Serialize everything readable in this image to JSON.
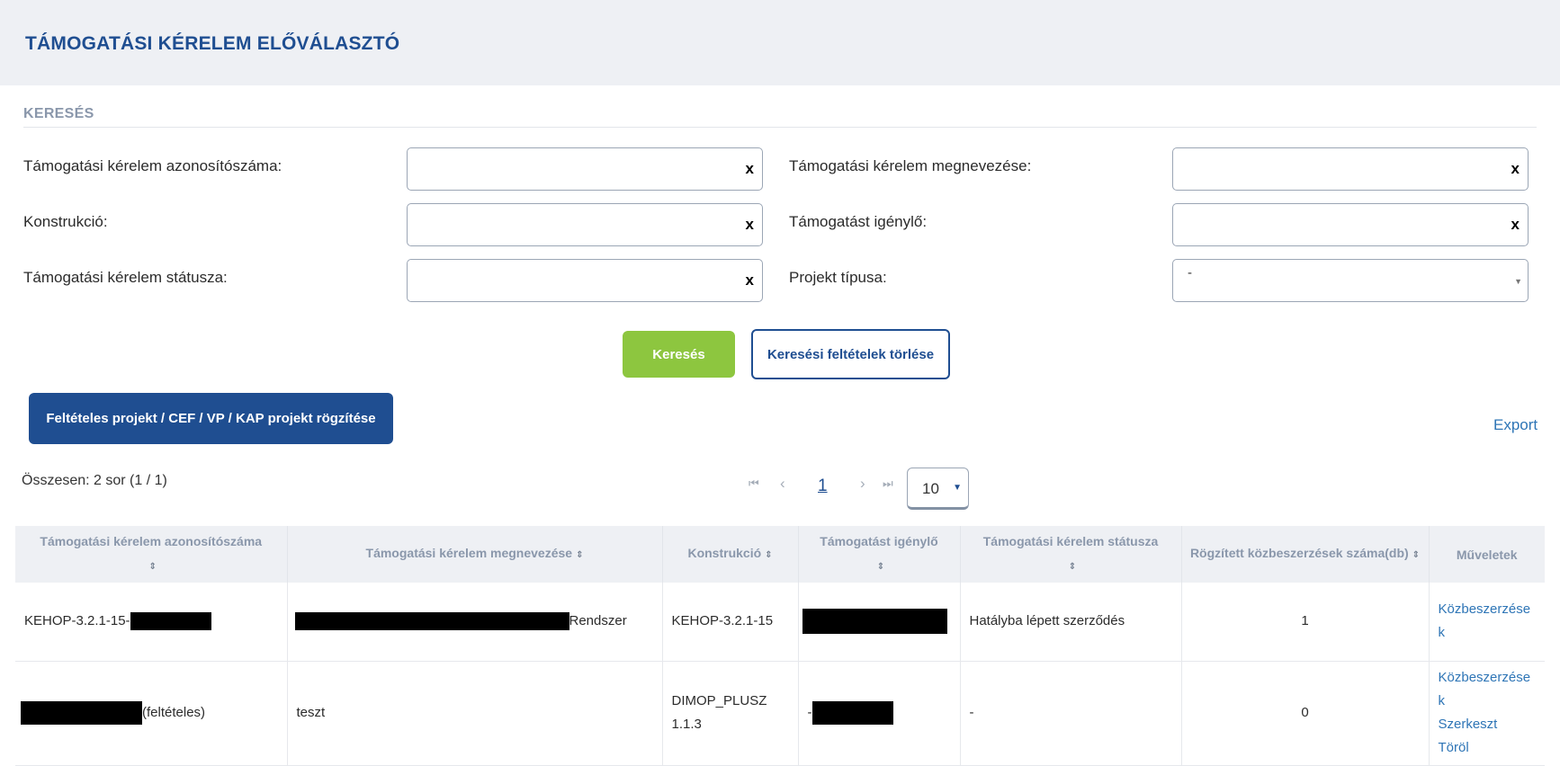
{
  "header": {
    "title": "TÁMOGATÁSI KÉRELEM ELŐVÁLASZTÓ"
  },
  "search": {
    "section_title": "KERESÉS",
    "fields": {
      "id_label": "Támogatási kérelem azonosítószáma:",
      "name_label": "Támogatási kérelem megnevezése:",
      "construction_label": "Konstrukció:",
      "applicant_label": "Támogatást igénylő:",
      "status_label": "Támogatási kérelem státusza:",
      "project_type_label": "Projekt típusa:",
      "project_type_value": "-",
      "clear_symbol": "x"
    },
    "search_button": "Keresés",
    "reset_button": "Keresési feltételek törlése"
  },
  "actions": {
    "new_project_button": "Feltételes projekt / CEF / VP / KAP projekt rögzítése",
    "export_link": "Export"
  },
  "results": {
    "total_text": "Összesen: 2 sor (1 / 1)",
    "pagination": {
      "first": "⏮",
      "prev": "‹",
      "current_page": "1",
      "next": "›",
      "last": "⏭",
      "page_size": "10"
    }
  },
  "table": {
    "columns": [
      "Támogatási kérelem azonosítószáma",
      "Támogatási kérelem megnevezése",
      "Konstrukció",
      "Támogatást igénylő",
      "Támogatási kérelem státusza",
      "Rögzített közbeszerzések száma(db)",
      "Műveletek"
    ],
    "sort_symbol": "⇕",
    "rows": [
      {
        "id_prefix": "KEHOP-3.2.1-15-",
        "name_suffix": "Rendszer",
        "construction": "KEHOP-3.2.1-15",
        "status": "Hatályba lépett szerződés",
        "count": "1",
        "action_procurement": "Közbeszerzések"
      },
      {
        "id_suffix": "(feltételes)",
        "name": "teszt",
        "construction": "DIMOP_PLUSZ 1.1.3",
        "applicant_prefix": "-",
        "status": "-",
        "count": "0",
        "action_procurement": "Közbeszerzések",
        "action_edit": "Szerkeszt",
        "action_delete": "Töröl"
      }
    ]
  },
  "colors": {
    "primary": "#1f4e91",
    "accent_green": "#8dc63f",
    "link": "#2e75b6",
    "header_bg": "#eef0f4"
  }
}
